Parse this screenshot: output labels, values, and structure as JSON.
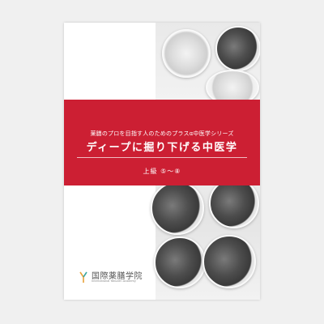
{
  "cover": {
    "series_line": "薬膳のプロを目指す人のためのプラスα中医学シリーズ",
    "title": "ディープに掘り下げる中医学",
    "volume": "上級 ⑤〜⑧",
    "publisher_name": "国際薬膳学院",
    "publisher_subtitle": "International Yakuzen Academy"
  },
  "colors": {
    "band": "#cc1f33",
    "background": "#f0f0f0",
    "logo_orange": "#e8a23a",
    "logo_teal": "#3aa7a0"
  }
}
